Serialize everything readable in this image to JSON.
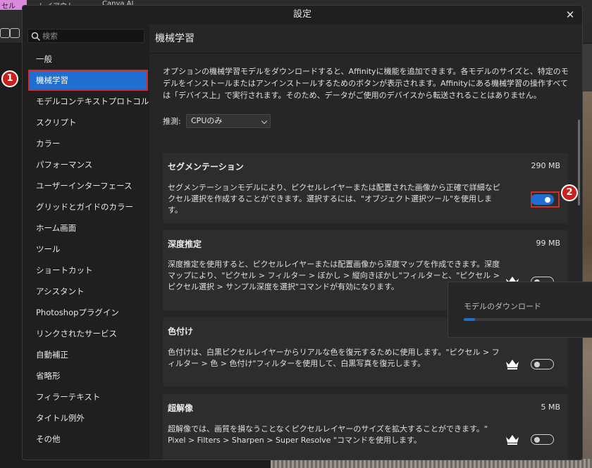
{
  "background_app": {
    "top_left_label": "セル",
    "top_text_1": "レイアウト",
    "top_text_2": "Canva AI"
  },
  "dialog": {
    "title": "設定",
    "close_label": "✕"
  },
  "search": {
    "placeholder": "検索"
  },
  "sidebar": {
    "items": [
      {
        "label": "一般"
      },
      {
        "label": "機械学習",
        "active": true
      },
      {
        "label": "モデルコンテキストプロトコル"
      },
      {
        "label": "スクリプト"
      },
      {
        "label": "カラー"
      },
      {
        "label": "パフォーマンス"
      },
      {
        "label": "ユーザーインターフェース"
      },
      {
        "label": "グリッドとガイドのカラー"
      },
      {
        "label": "ホーム画面"
      },
      {
        "label": "ツール"
      },
      {
        "label": "ショートカット"
      },
      {
        "label": "アシスタント"
      },
      {
        "label": "Photoshopプラグイン"
      },
      {
        "label": "リンクされたサービス"
      },
      {
        "label": "自動補正"
      },
      {
        "label": "省略形"
      },
      {
        "label": "フィラーテキスト"
      },
      {
        "label": "タイトル例外"
      },
      {
        "label": "その他"
      }
    ]
  },
  "content": {
    "title": "機械学習",
    "intro": "オプションの機械学習モデルをダウンロードすると、Affinityに機能を追加できます。各モデルのサイズと、特定のモデルをインストールまたはアンインストールするためのボタンが表示されます。Affinityにある機械学習の操作すべては「デバイス上」で実行されます。そのため、データがご使用のデバイスから転送されることはありません。",
    "inference_label": "推測:",
    "inference_value": "CPUのみ"
  },
  "models": [
    {
      "title": "セグメンテーション",
      "size": "290 MB",
      "description": "セグメンテーションモデルにより、ピクセルレイヤーまたは配置された画像から正確で詳細なピクセル選択を作成することができます。選択するには、\"オブジェクト選択ツール\"を使用します。",
      "enabled": true,
      "premium": false
    },
    {
      "title": "深度推定",
      "size": "99 MB",
      "description": "深度推定を使用すると、ピクセルレイヤーまたは配置画像から深度マップを作成できます。深度マップにより、\"ピクセル > フィルター > ぼかし > 縦向きぼかし\"フィルターと、\"ピクセル > ピクセル選択 > サンプル深度を選択\"コマンドが有効になります。",
      "enabled": false,
      "premium": true
    },
    {
      "title": "色付け",
      "size": "",
      "description": "色付けは、白黒ピクセルレイヤーからリアルな色を復元するために使用します。\"ピクセル > フィルター > 色 > 色付け\"フィルターを使用して、白黒写真を復元します。",
      "enabled": false,
      "premium": true
    },
    {
      "title": "超解像",
      "size": "5 MB",
      "description": "超解像では、画質を損なうことなくピクセルレイヤーのサイズを拡大することができます。\" Pixel > Filters > Sharpen > Super Resolve \"コマンドを使用します。",
      "enabled": false,
      "premium": true
    }
  ],
  "download_panel": {
    "label": "モデルのダウンロード",
    "progress_percent": 8
  },
  "annotations": {
    "badge_1": "1",
    "badge_2": "2"
  },
  "colors": {
    "accent": "#1f6fd1",
    "highlight_red": "#d42a2a",
    "dialog_bg": "#1f1f1f",
    "content_bg": "#262626",
    "card_bg": "#2d2d2d"
  }
}
